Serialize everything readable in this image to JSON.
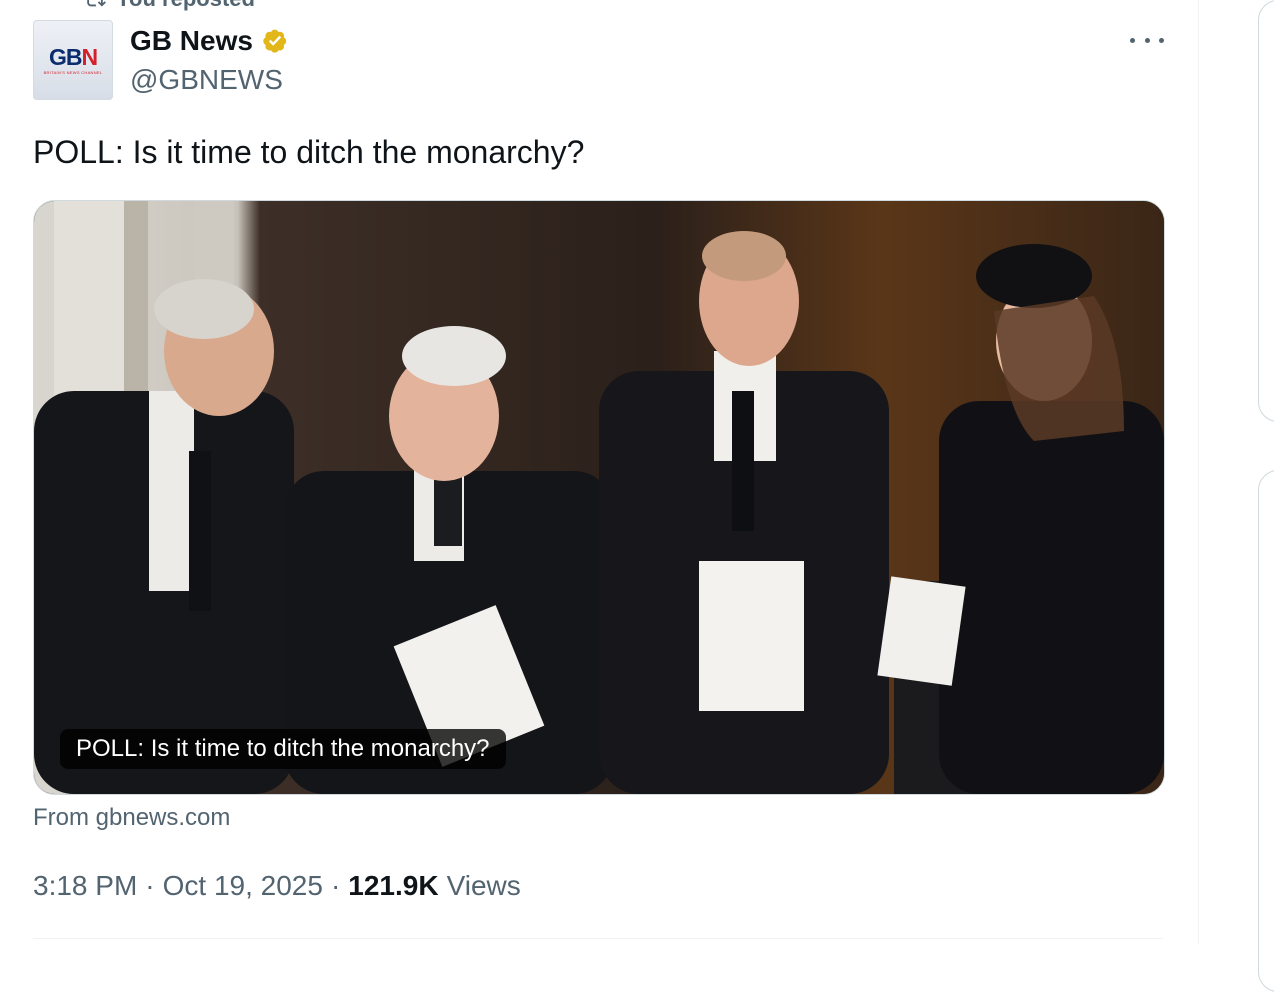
{
  "repost": {
    "label": "You reposted"
  },
  "author": {
    "avatar_logo": "GBN",
    "avatar_tagline": "BRITAIN'S NEWS CHANNEL",
    "display_name": "GB News",
    "handle": "@GBNEWS",
    "verified": true,
    "verified_color": "#e2b719"
  },
  "tweet": {
    "text": "POLL: Is it time to ditch the monarchy?",
    "media_caption": "POLL: Is it time to ditch the monarchy?",
    "source": "From gbnews.com",
    "time": "3:18 PM",
    "date": "Oct 19, 2025",
    "views_count": "121.9K",
    "views_label": "Views"
  },
  "colors": {
    "secondary_text": "#536471",
    "primary_text": "#0f1419",
    "border": "#cfd9de"
  },
  "icons": {
    "repost": "repost-icon",
    "verified": "verified-badge-icon",
    "more": "more-options-icon"
  }
}
